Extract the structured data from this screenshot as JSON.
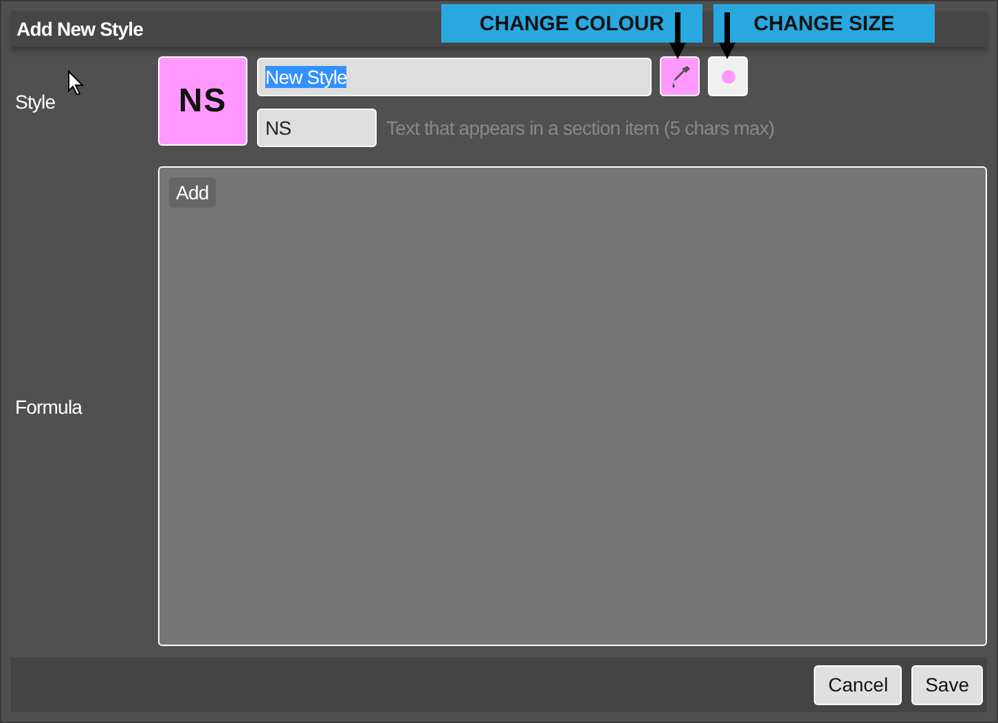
{
  "dialog": {
    "title": "Add New Style"
  },
  "style": {
    "label": "Style",
    "preview": "NS",
    "color": "#ff99ff",
    "name": {
      "value": "New Style",
      "text_selected": true
    },
    "abbreviation": {
      "value": "NS"
    },
    "hint": "Text that appears in a section item (5 chars max)"
  },
  "formula": {
    "label": "Formula",
    "add_button": "Add"
  },
  "buttons": [
    "Cancel",
    "Save"
  ],
  "callouts": [
    "CHANGE COLOUR",
    "CHANGE SIZE"
  ]
}
